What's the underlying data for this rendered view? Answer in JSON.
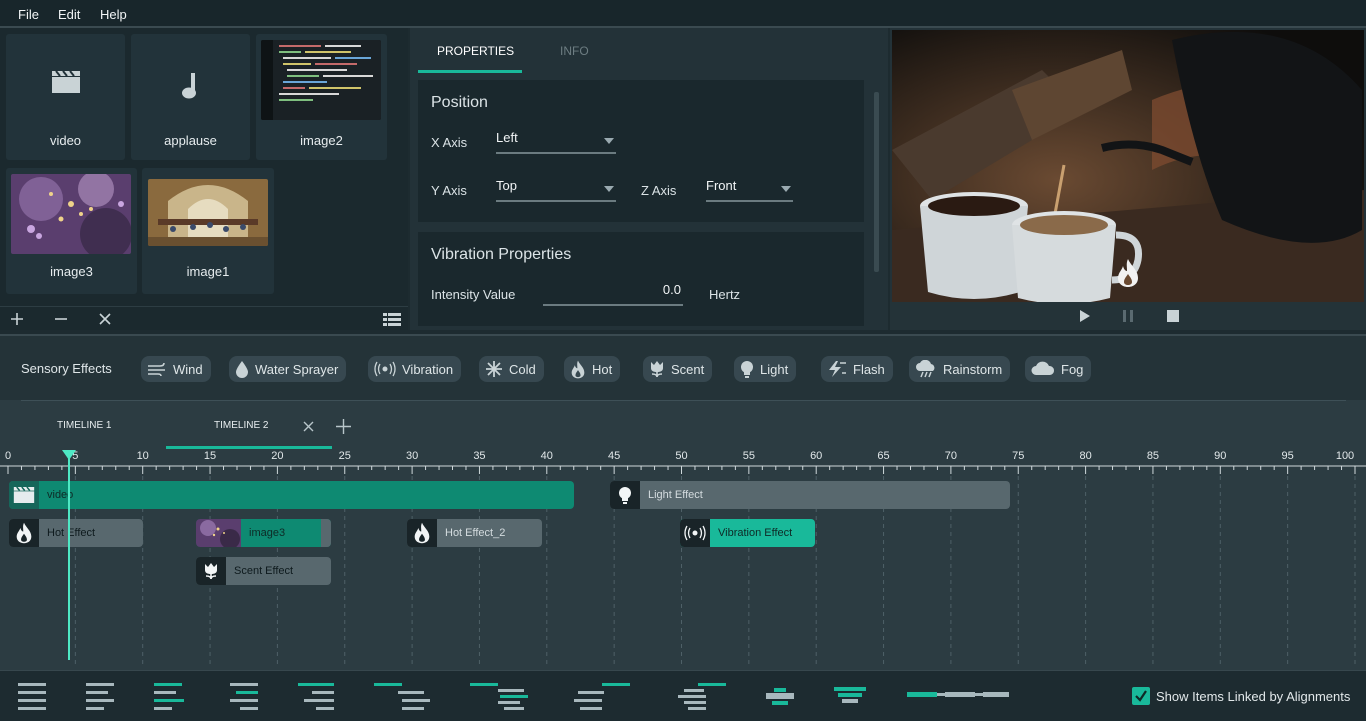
{
  "menu": {
    "file": "File",
    "edit": "Edit",
    "help": "Help"
  },
  "media": {
    "items": [
      {
        "label": "video",
        "icon": "clapperboard-icon"
      },
      {
        "label": "applause",
        "icon": "music-note-icon"
      },
      {
        "label": "image2",
        "icon": "code-thumbnail"
      },
      {
        "label": "image3",
        "icon": "lavender-thumbnail"
      },
      {
        "label": "image1",
        "icon": "fresco-thumbnail"
      }
    ]
  },
  "properties": {
    "tabs": {
      "properties": "PROPERTIES",
      "info": "INFO"
    },
    "position": {
      "title": "Position",
      "x_label": "X Axis",
      "x_value": "Left",
      "y_label": "Y Axis",
      "y_value": "Top",
      "z_label": "Z Axis",
      "z_value": "Front"
    },
    "vibration": {
      "title": "Vibration Properties",
      "intensity_label": "Intensity Value",
      "intensity_value": "0.0",
      "unit": "Hertz"
    }
  },
  "effects": {
    "label": "Sensory Effects",
    "chips": [
      "Wind",
      "Water Sprayer",
      "Vibration",
      "Cold",
      "Hot",
      "Scent",
      "Light",
      "Flash",
      "Rainstorm",
      "Fog"
    ]
  },
  "timeline": {
    "tabs": [
      "TIMELINE 1",
      "TIMELINE 2"
    ],
    "active_tab": "TIMELINE 2",
    "ticks": [
      "0",
      "5",
      "10",
      "15",
      "20",
      "25",
      "30",
      "35",
      "40",
      "45",
      "50",
      "55",
      "60",
      "65",
      "70",
      "75",
      "80",
      "85",
      "90",
      "95",
      "100"
    ],
    "playhead": 4.5,
    "clips": {
      "video": "video",
      "light": "Light Effect",
      "hot": "Hot Effect",
      "image3": "image3",
      "hot2": "Hot Effect_2",
      "vibration": "Vibration Effect",
      "scent": "Scent Effect"
    }
  },
  "bottom": {
    "show_linked": "Show Items Linked by Alignments",
    "show_linked_checked": true
  },
  "colors": {
    "accent": "#19b99a",
    "teal_dark": "#0e8a72",
    "bg": "#1d2b30"
  }
}
